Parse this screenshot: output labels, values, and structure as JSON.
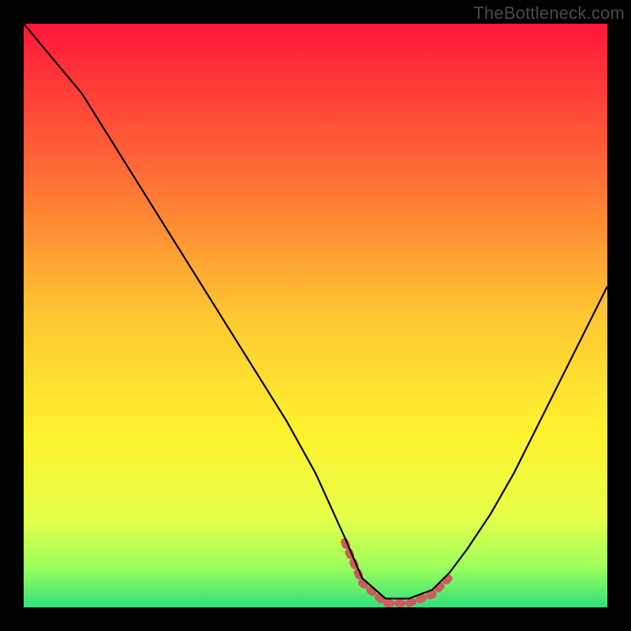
{
  "watermark": "TheBottleneck.com",
  "chart_data": {
    "type": "line",
    "title": "",
    "xlabel": "",
    "ylabel": "",
    "xlim": [
      0,
      100
    ],
    "ylim": [
      0,
      100
    ],
    "grid": false,
    "legend": false,
    "series": [
      {
        "name": "bottleneck-curve",
        "x": [
          0,
          5,
          10,
          15,
          20,
          25,
          30,
          35,
          40,
          45,
          50,
          55,
          58,
          62,
          66,
          70,
          73,
          76,
          80,
          84,
          88,
          92,
          96,
          100
        ],
        "values": [
          100,
          94,
          88,
          80,
          72,
          64,
          56,
          48,
          40,
          32,
          23,
          12,
          5,
          1.5,
          1.5,
          3,
          6,
          10,
          16,
          23,
          31,
          39,
          47,
          55
        ]
      }
    ],
    "highlight_band": {
      "note": "flat minimum region on the curve, drawn as dashed salmon segment",
      "x_start": 55,
      "x_end": 73,
      "y_at_band": 2
    },
    "background_gradient": {
      "stops": [
        {
          "offset": 0.0,
          "color": "#ff173a"
        },
        {
          "offset": 0.25,
          "color": "#ff6a36"
        },
        {
          "offset": 0.5,
          "color": "#ffc731"
        },
        {
          "offset": 0.7,
          "color": "#fff22e"
        },
        {
          "offset": 0.85,
          "color": "#e4ff4a"
        },
        {
          "offset": 0.93,
          "color": "#9dff5c"
        },
        {
          "offset": 1.0,
          "color": "#34e07a"
        }
      ]
    }
  }
}
